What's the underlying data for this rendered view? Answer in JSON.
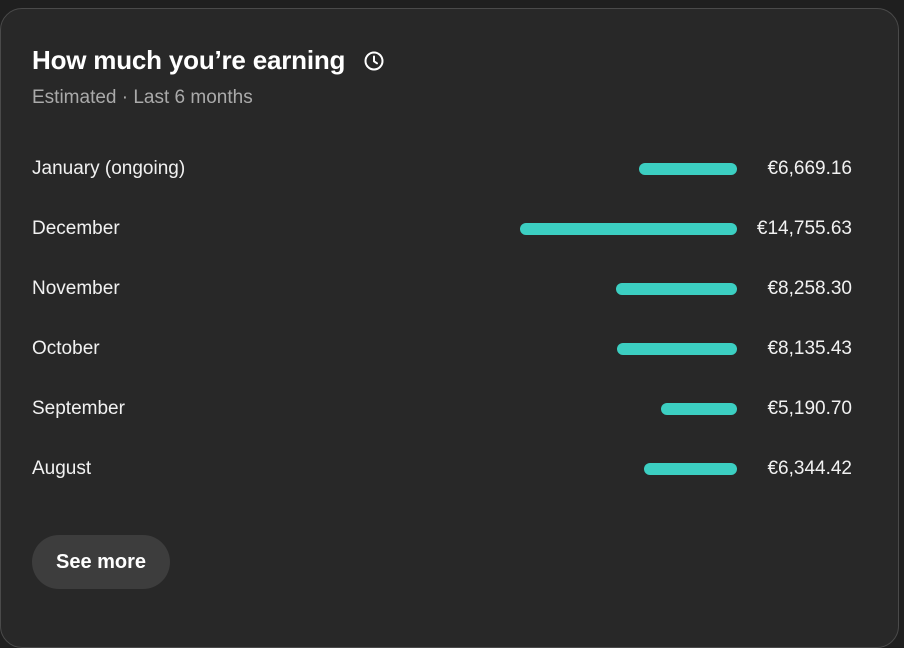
{
  "card": {
    "title": "How much you’re earning",
    "info_icon": "clock-info-icon",
    "subtitle": "Estimated · Last 6 months"
  },
  "chart_data": {
    "type": "bar",
    "orientation": "horizontal",
    "currency": "€",
    "categories": [
      "January (ongoing)",
      "December",
      "November",
      "October",
      "September",
      "August"
    ],
    "values": [
      6669.16,
      14755.63,
      8258.3,
      8135.43,
      5190.7,
      6344.42
    ],
    "value_labels": [
      "€6,669.16",
      "€14,755.63",
      "€8,258.30",
      "€8,135.43",
      "€5,190.70",
      "€6,344.42"
    ],
    "bar_color": "#3ccfc2"
  },
  "actions": {
    "see_more_label": "See more"
  },
  "colors": {
    "card_background": "#282828",
    "page_background": "#1f1f1f",
    "accent": "#3ccfc2",
    "button_background": "#3d3d3d"
  }
}
